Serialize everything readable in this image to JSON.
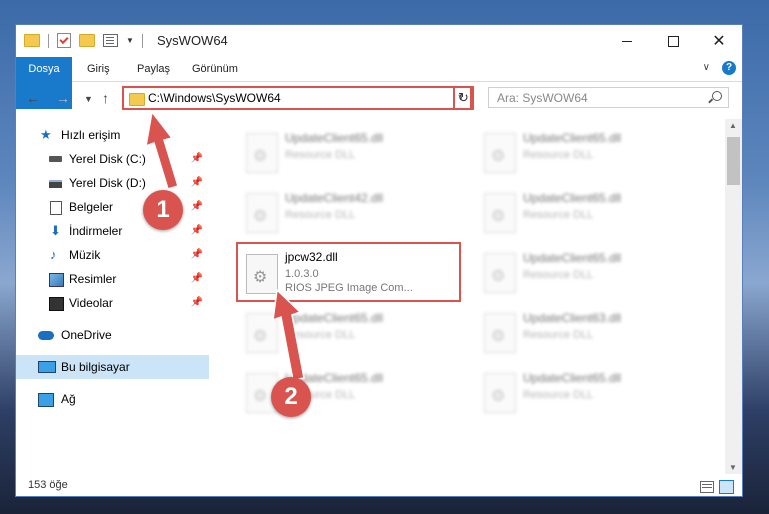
{
  "window": {
    "title": "SysWOW64"
  },
  "ribbon": {
    "tabs": [
      "Dosya",
      "Giriş",
      "Paylaş",
      "Görünüm"
    ],
    "help": "?"
  },
  "address": {
    "path": "C:\\Windows\\SysWOW64",
    "search_placeholder": "Ara: SysWOW64"
  },
  "sidebar": {
    "items": [
      {
        "label": "Hızlı erişim"
      },
      {
        "label": "Yerel Disk (C:)"
      },
      {
        "label": "Yerel Disk (D:)"
      },
      {
        "label": "Belgeler"
      },
      {
        "label": "İndirmeler"
      },
      {
        "label": "Müzik"
      },
      {
        "label": "Resimler"
      },
      {
        "label": "Videolar"
      },
      {
        "label": "OneDrive"
      },
      {
        "label": "Bu bilgisayar"
      },
      {
        "label": "Ağ"
      }
    ]
  },
  "files": [
    {
      "name": "UpdateClient65.dll",
      "sub": "Resource DLL"
    },
    {
      "name": "UpdateClient65.dll",
      "sub": "Resource DLL"
    },
    {
      "name": "UpdateClient42.dll",
      "sub": "Resource DLL"
    },
    {
      "name": "UpdateClient65.dll",
      "sub": "Resource DLL"
    },
    {
      "name": "jpcw32.dll",
      "version": "1.0.3.0",
      "desc": "RIOS JPEG Image Com..."
    },
    {
      "name": "UpdateClient65.dll",
      "sub": "Resource DLL"
    },
    {
      "name": "UpdateClient65.dll",
      "sub": "Resource DLL"
    },
    {
      "name": "UpdateClient63.dll",
      "sub": "Resource DLL"
    },
    {
      "name": "UpdateClient65.dll",
      "sub": "Resource DLL"
    },
    {
      "name": "UpdateClient65.dll",
      "sub": "Resource DLL"
    }
  ],
  "status": {
    "count": "153 öğe"
  },
  "annotations": {
    "step1": "1",
    "step2": "2",
    "color": "#d9534f"
  }
}
